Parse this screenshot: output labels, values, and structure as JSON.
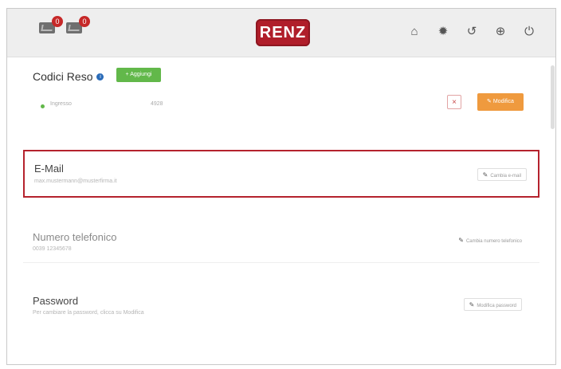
{
  "header": {
    "badges": [
      "0",
      "0"
    ],
    "logo_text": "RENZ",
    "icons": [
      "home-icon",
      "gear-icon",
      "history-icon",
      "globe-icon",
      "power-icon"
    ]
  },
  "codes": {
    "title": "Codici Reso",
    "add_label": "+ Aggiungi",
    "rows": [
      {
        "label": "Ingresso",
        "value": "4928"
      }
    ],
    "delete_label": "×",
    "edit_label": "Modifica"
  },
  "email": {
    "title": "E-Mail",
    "value": "max.mustermann@musterfirma.it",
    "action_label": "Cambia e-mail"
  },
  "phone": {
    "title": "Numero telefonico",
    "value": "0039 12345678",
    "action_label": "Cambia numero telefonico"
  },
  "password": {
    "title": "Password",
    "value": "Per cambiare la password, clicca su Modifica",
    "action_label": "Modifica password"
  },
  "colors": {
    "brand": "#b01e2a",
    "add_button": "#62b84a",
    "edit_button": "#ef9a3e",
    "highlight_border": "#b5222d"
  }
}
